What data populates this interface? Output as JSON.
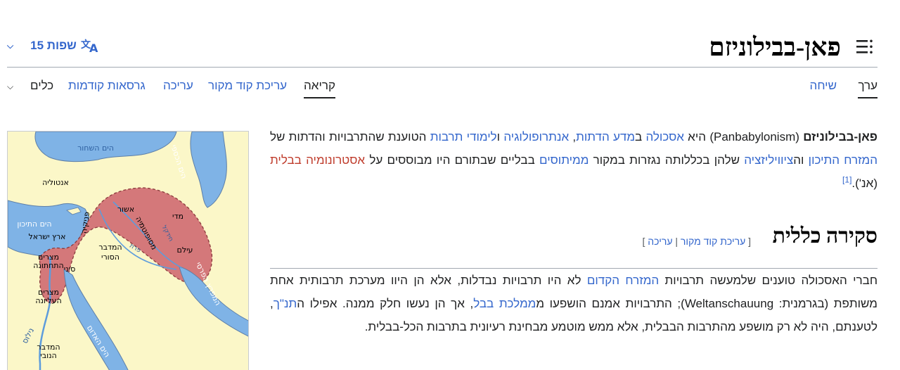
{
  "header": {
    "title": "פאן-בבילוניזם",
    "languages_label": "15 שפות"
  },
  "tabs": {
    "right": [
      {
        "label": "ערך",
        "selected": true
      },
      {
        "label": "שיחה",
        "selected": false
      }
    ],
    "left": [
      {
        "label": "קריאה",
        "selected": true
      },
      {
        "label": "עריכת קוד מקור"
      },
      {
        "label": "עריכה"
      },
      {
        "label": "גרסאות קודמות"
      },
      {
        "label": "כלים"
      }
    ]
  },
  "lead": {
    "term": "פאן-בבילוניזם",
    "term_latin": "(Panbabylonism)",
    "t1": " היא ",
    "l_school": "אסכולה",
    "t2": " ב",
    "l_religion": "מדע הדתות",
    "t3": ", ",
    "l_anthro": "אנתרופולוגיה",
    "t4": " ו",
    "l_culture": "לימודי תרבות",
    "t5": " הטוענת שהתרבויות והדתות של ",
    "l_mideast": "המזרח התיכון",
    "t6": " וה",
    "l_civ": "ציוויליזציה",
    "t7": " שלהן בכללותה נגזרות במקור ",
    "l_myths": "ממיתוסים",
    "t8": " בבליים שבתורם היו מבוססים על ",
    "l_astro": "אסטרונומיה בבלית",
    "t9": " (אנ')",
    "ref": "[1]",
    "t10": "."
  },
  "section": {
    "title": "סקירה כללית",
    "edit_open": "[",
    "edit_source": "עריכת קוד מקור",
    "edit_sep": "|",
    "edit": "עריכה",
    "edit_close": "]",
    "s1": "חברי האסכולה טוענים שלמעשה תרבויות ",
    "l_neareast": "המזרח הקדום",
    "s2": " לא היו תרבויות נבדלות, אלא הן היוו מערכת תרבותית אחת משותפת (בגרמנית: Weltanschauung); התרבויות אמנם הושפעו מ",
    "l_babylon": "ממלכת בבל",
    "s3": ", אך הן נעשו חלק ממנה. אפילו ה",
    "l_tanakh": "תנ\"ך",
    "s4": ", לטענתם, היה לא רק מושפע מהתרבות הבבלית, אלא ממש מוטמע מבחינת רעיונית בתרבות הכל-בבלית."
  },
  "map": {
    "labels": {
      "black_sea": "הים השחור",
      "caspian": "הים הכספי",
      "anatolia": "אנטוליה",
      "mediterranean": "הים התיכון",
      "israel": "ארץ ישראל",
      "phoenicia": "פניקיה",
      "assyria": "אשור",
      "media": "מדי",
      "mesopotamia": "מסופוטמיה",
      "tigris": "חידקל",
      "euphrates": "פרת",
      "elam": "עילם",
      "syrian_desert_1": "המדבר",
      "syrian_desert_2": "הסורי",
      "lower_egypt_1": "מצרים",
      "lower_egypt_2": "התחתונה",
      "sinai": "סיני",
      "upper_egypt_1": "מצרים",
      "upper_egypt_2": "העליונה",
      "persian_gulf": "המפרץ הפרסי",
      "nile": "נילוס",
      "red_sea": "הים האדום",
      "nubian_desert_1": "המדבר",
      "nubian_desert_2": "הנובי"
    },
    "colors": {
      "land": "#fbf7c8",
      "water": "#7fb3e6",
      "crescent": "#d4787a"
    }
  }
}
